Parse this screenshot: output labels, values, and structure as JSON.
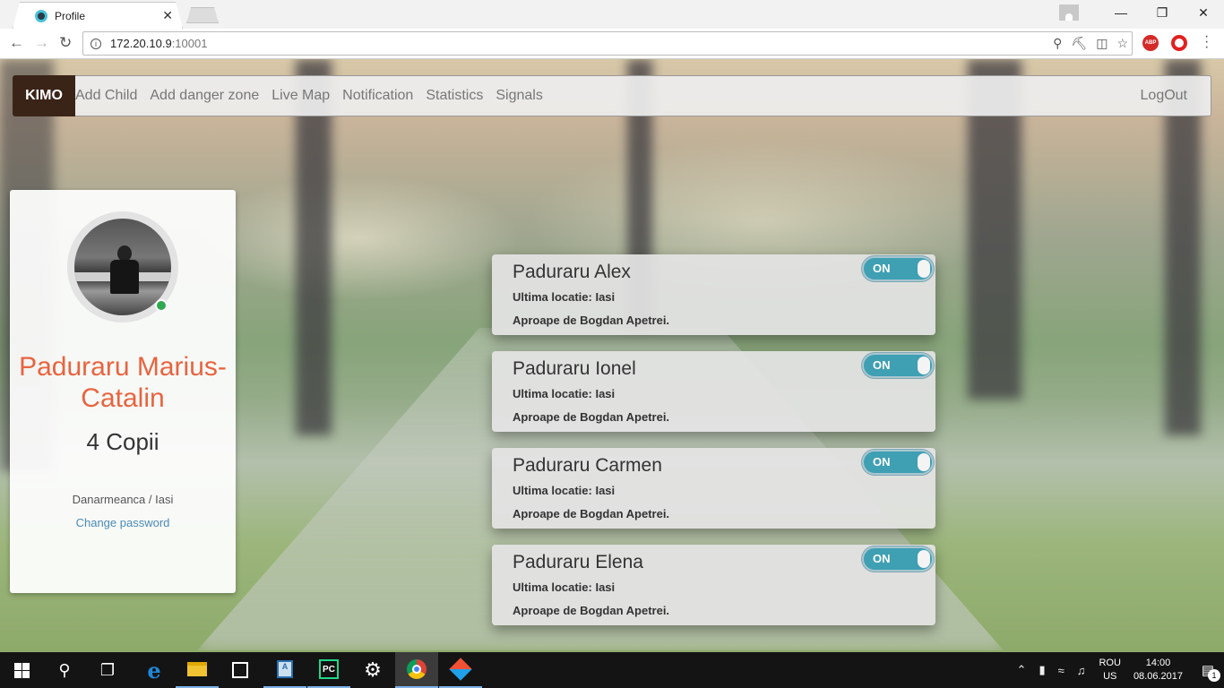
{
  "browser": {
    "tab_title": "Profile",
    "tab_close": "✕",
    "url_host": "172.20.10.9",
    "url_port": ":10001",
    "nav_back": "←",
    "nav_forward": "→",
    "nav_reload": "↻",
    "window_controls": {
      "minimize": "—",
      "restore": "❐",
      "close": "✕"
    },
    "extension_abp": "ABP"
  },
  "navbar": {
    "brand": "KIMO",
    "links": [
      "Add Child",
      "Add danger zone",
      "Live Map",
      "Notification",
      "Statistics",
      "Signals"
    ],
    "logout": "LogOut"
  },
  "profile": {
    "name": "Paduraru Marius-Catalin",
    "children_count": "4 Copii",
    "location": "Danarmeanca / Iasi",
    "change_password": "Change password",
    "online_color": "#2fa84f",
    "name_color": "#e8643f"
  },
  "children": [
    {
      "name": "Paduraru Alex",
      "location": "Ultima locatie: Iasi",
      "near": "Aproape de Bogdan Apetrei.",
      "toggle": "ON"
    },
    {
      "name": "Paduraru Ionel",
      "location": "Ultima locatie: Iasi",
      "near": "Aproape de Bogdan Apetrei.",
      "toggle": "ON"
    },
    {
      "name": "Paduraru Carmen",
      "location": "Ultima locatie: Iasi",
      "near": "Aproape de Bogdan Apetrei.",
      "toggle": "ON"
    },
    {
      "name": "Paduraru Elena",
      "location": "Ultima locatie: Iasi",
      "near": "Aproape de Bogdan Apetrei.",
      "toggle": "ON"
    }
  ],
  "taskbar": {
    "pc_label": "PC",
    "doc_label": "A",
    "language_top": "ROU",
    "language_bottom": "US",
    "time": "14:00",
    "date": "08.06.2017",
    "notification_count": "1"
  },
  "colors": {
    "brand_bg": "#3a2418",
    "toggle_on": "#3f9fb3",
    "link": "#4a8ab8"
  }
}
